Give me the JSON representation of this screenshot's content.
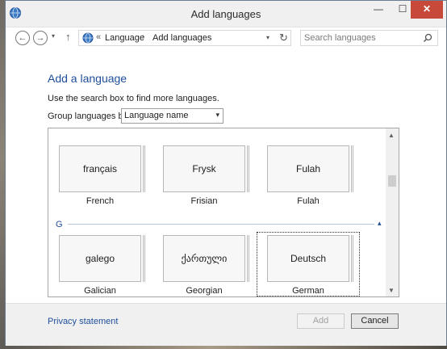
{
  "window": {
    "title": "Add languages",
    "controls": {
      "minimize": "—",
      "maximize": "☐",
      "close": "✕"
    }
  },
  "nav": {
    "back_glyph": "←",
    "forward_glyph": "→",
    "recent_glyph": "▾",
    "up_glyph": "↑",
    "address_prefix": "«",
    "breadcrumbs": [
      "Language",
      "Add languages"
    ],
    "separator": "›",
    "address_dropdown_glyph": "▾",
    "refresh_glyph": "↻",
    "search_placeholder": "Search languages"
  },
  "content": {
    "heading": "Add a language",
    "hint": "Use the search box to find more languages.",
    "group_label": "Group languages by:",
    "group_by_value": "Language name",
    "group_by_arrow": "▾"
  },
  "list": {
    "rows": [
      {
        "tiles": [
          {
            "native": "français",
            "caption": "French"
          },
          {
            "native": "Frysk",
            "caption": "Frisian"
          },
          {
            "native": "Fulah",
            "caption": "Fulah"
          }
        ]
      },
      {
        "group_letter": "G",
        "group_toggle": "▴",
        "tiles": [
          {
            "native": "galego",
            "caption": "Galician"
          },
          {
            "native": "ქართული",
            "caption": "Georgian"
          },
          {
            "native": "Deutsch",
            "caption": "German"
          }
        ]
      }
    ],
    "scroll_up": "▲",
    "scroll_down": "▼"
  },
  "footer": {
    "privacy": "Privacy statement",
    "add_label": "Add",
    "cancel_label": "Cancel"
  },
  "colors": {
    "accent": "#1f4e9a",
    "close_button": "#c7493a"
  },
  "icons": [
    "globe-icon",
    "back-icon",
    "forward-icon",
    "up-icon",
    "refresh-icon",
    "search-icon",
    "chevron-down-icon"
  ]
}
